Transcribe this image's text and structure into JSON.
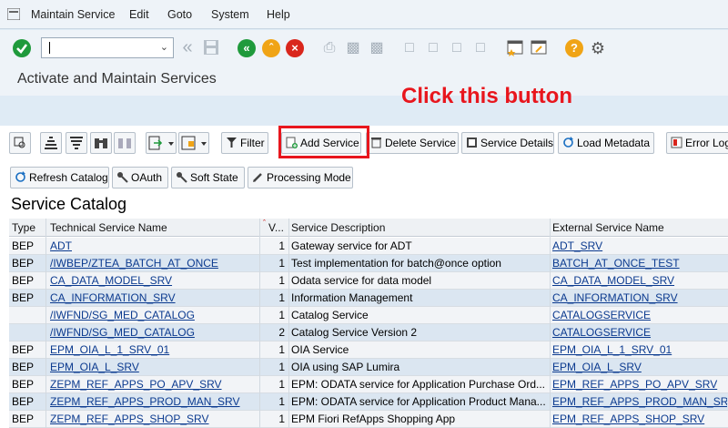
{
  "menu": {
    "items": [
      "Maintain Service",
      "Edit",
      "Goto",
      "System",
      "Help"
    ]
  },
  "command_field": {
    "value": ""
  },
  "page": {
    "title": "Activate and Maintain Services"
  },
  "annotation": "Click this button",
  "toolbar": {
    "filter": "Filter",
    "add_service": "Add Service",
    "delete_service": "Delete Service",
    "service_details": "Service Details",
    "load_metadata": "Load Metadata",
    "error_log": "Error Log",
    "refresh_catalog": "Refresh Catalog",
    "oauth": "OAuth",
    "soft_state": "Soft State",
    "processing_mode": "Processing Mode"
  },
  "catalog": {
    "title": "Service Catalog",
    "columns": [
      "Type",
      "Technical Service Name",
      "V...",
      "Service Description",
      "External Service Name"
    ],
    "rows": [
      [
        "BEP",
        "ADT",
        "1",
        "Gateway service for ADT",
        "ADT_SRV"
      ],
      [
        "BEP",
        "/IWBEP/ZTEA_BATCH_AT_ONCE",
        "1",
        "Test implementation for batch@once option",
        "BATCH_AT_ONCE_TEST"
      ],
      [
        "BEP",
        "CA_DATA_MODEL_SRV",
        "1",
        "Odata service for data model",
        "CA_DATA_MODEL_SRV"
      ],
      [
        "BEP",
        "CA_INFORMATION_SRV",
        "1",
        "Information Management",
        "CA_INFORMATION_SRV"
      ],
      [
        "",
        "/IWFND/SG_MED_CATALOG",
        "1",
        "Catalog Service",
        "CATALOGSERVICE"
      ],
      [
        "",
        "/IWFND/SG_MED_CATALOG",
        "2",
        "Catalog Service Version 2",
        "CATALOGSERVICE"
      ],
      [
        "BEP",
        "EPM_OIA_L_1_SRV_01",
        "1",
        "OIA Service",
        "EPM_OIA_L_1_SRV_01"
      ],
      [
        "BEP",
        "EPM_OIA_L_SRV",
        "1",
        "OIA using SAP Lumira",
        "EPM_OIA_L_SRV"
      ],
      [
        "BEP",
        "ZEPM_REF_APPS_PO_APV_SRV",
        "1",
        "EPM: ODATA service for Application Purchase Ord...",
        "EPM_REF_APPS_PO_APV_SRV"
      ],
      [
        "BEP",
        "ZEPM_REF_APPS_PROD_MAN_SRV",
        "1",
        "EPM: ODATA service for Application Product Mana...",
        "EPM_REF_APPS_PROD_MAN_SRV"
      ],
      [
        "BEP",
        "ZEPM_REF_APPS_SHOP_SRV",
        "1",
        "EPM Fiori RefApps Shopping App",
        "EPM_REF_APPS_SHOP_SRV"
      ]
    ]
  }
}
